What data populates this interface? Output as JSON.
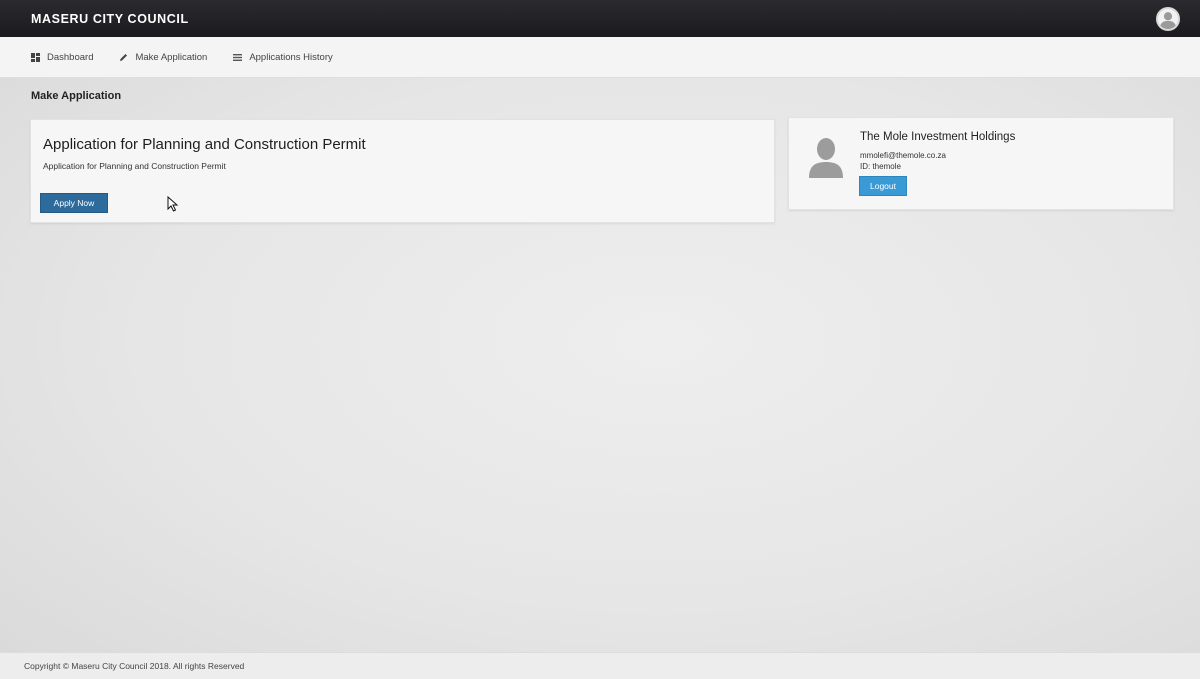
{
  "header": {
    "brand": "MASERU CITY COUNCIL"
  },
  "nav": {
    "items": [
      {
        "label": "Dashboard",
        "icon": "dashboard-icon"
      },
      {
        "label": "Make Application",
        "icon": "pencil-icon"
      },
      {
        "label": "Applications History",
        "icon": "list-icon"
      }
    ]
  },
  "page": {
    "title": "Make Application"
  },
  "application_card": {
    "title": "Application for Planning and Construction Permit",
    "description": "Application for Planning and Construction Permit",
    "apply_label": "Apply Now"
  },
  "profile": {
    "name": "The Mole Investment Holdings",
    "email": "mmolefi@themole.co.za",
    "id": "ID: themole",
    "logout_label": "Logout"
  },
  "footer": {
    "text": "Copyright © Maseru City Council 2018. All rights Reserved"
  },
  "colors": {
    "topbar": "#1f1f23",
    "apply_button": "#2c6b9c",
    "logout_button": "#3a9ad6"
  }
}
